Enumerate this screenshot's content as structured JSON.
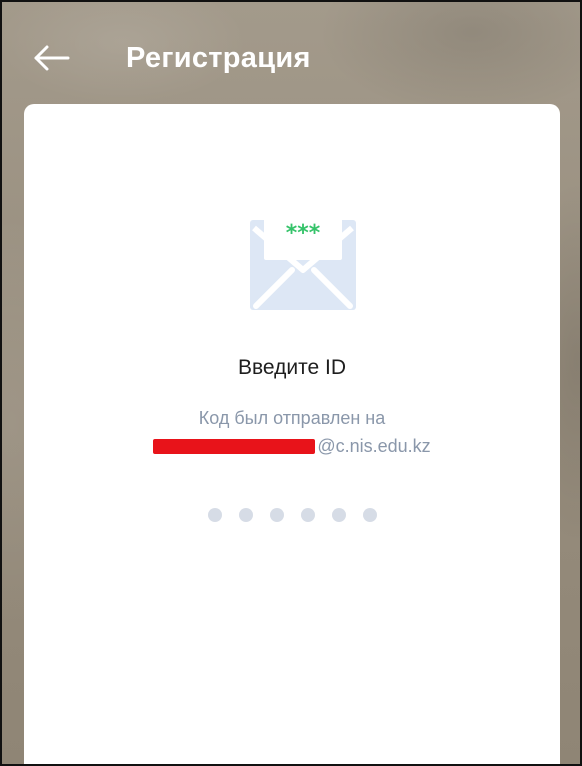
{
  "header": {
    "back_icon": "arrow-left-icon",
    "title": "Регистрация"
  },
  "card": {
    "icon": "envelope-password-icon",
    "icon_symbol": "***",
    "heading": "Введите ID",
    "message_line1": "Код был отправлен на",
    "email_domain_visible": "@c.nis.edu.kz",
    "code_length": 6
  },
  "colors": {
    "header_background": "#9d9384",
    "card_background": "#ffffff",
    "icon_tint": "#dde7f5",
    "icon_stars": "#35c36a",
    "subtext": "#8a97aa",
    "code_dot": "#d6dce6",
    "redaction": "#e8131a"
  }
}
